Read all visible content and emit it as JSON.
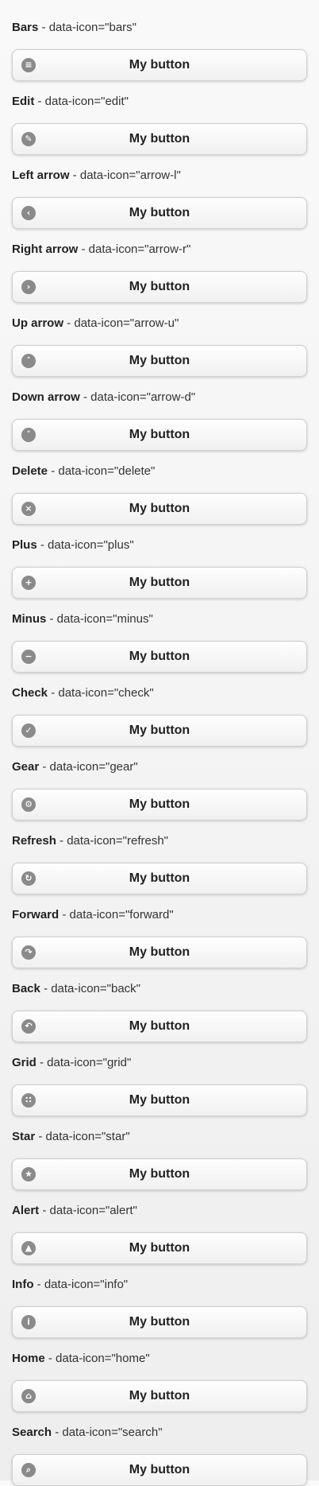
{
  "button_label": "My button",
  "items": [
    {
      "title": "Bars",
      "desc": " - data-icon=\"bars\"",
      "icon": "bars-icon",
      "glyph": "≡"
    },
    {
      "title": "Edit",
      "desc": " - data-icon=\"edit\"",
      "icon": "edit-icon",
      "glyph": "✎"
    },
    {
      "title": "Left arrow",
      "desc": " - data-icon=\"arrow-l\"",
      "icon": "arrow-left-icon",
      "glyph": "‹"
    },
    {
      "title": "Right arrow",
      "desc": " - data-icon=\"arrow-r\"",
      "icon": "arrow-right-icon",
      "glyph": "›"
    },
    {
      "title": "Up arrow",
      "desc": " - data-icon=\"arrow-u\"",
      "icon": "arrow-up-icon",
      "glyph": "˄"
    },
    {
      "title": "Down arrow",
      "desc": " - data-icon=\"arrow-d\"",
      "icon": "arrow-down-icon",
      "glyph": "˅"
    },
    {
      "title": "Delete",
      "desc": " - data-icon=\"delete\"",
      "icon": "delete-icon",
      "glyph": "×"
    },
    {
      "title": "Plus",
      "desc": " - data-icon=\"plus\"",
      "icon": "plus-icon",
      "glyph": "+"
    },
    {
      "title": "Minus",
      "desc": " - data-icon=\"minus\"",
      "icon": "minus-icon",
      "glyph": "−"
    },
    {
      "title": "Check",
      "desc": " - data-icon=\"check\"",
      "icon": "check-icon",
      "glyph": "✓"
    },
    {
      "title": "Gear",
      "desc": " - data-icon=\"gear\"",
      "icon": "gear-icon",
      "glyph": "⚙"
    },
    {
      "title": "Refresh",
      "desc": " - data-icon=\"refresh\"",
      "icon": "refresh-icon",
      "glyph": "↻"
    },
    {
      "title": "Forward",
      "desc": " - data-icon=\"forward\"",
      "icon": "forward-icon",
      "glyph": "↷"
    },
    {
      "title": "Back",
      "desc": " - data-icon=\"back\"",
      "icon": "back-icon",
      "glyph": "↶"
    },
    {
      "title": "Grid",
      "desc": " - data-icon=\"grid\"",
      "icon": "grid-icon",
      "glyph": "∷"
    },
    {
      "title": "Star",
      "desc": " - data-icon=\"star\"",
      "icon": "star-icon",
      "glyph": "★"
    },
    {
      "title": "Alert",
      "desc": " - data-icon=\"alert\"",
      "icon": "alert-icon",
      "glyph": "▲"
    },
    {
      "title": "Info",
      "desc": " - data-icon=\"info\"",
      "icon": "info-icon",
      "glyph": "i"
    },
    {
      "title": "Home",
      "desc": " - data-icon=\"home\"",
      "icon": "home-icon",
      "glyph": "⌂"
    },
    {
      "title": "Search",
      "desc": " - data-icon=\"search\"",
      "icon": "search-icon",
      "glyph": "⌕"
    }
  ]
}
